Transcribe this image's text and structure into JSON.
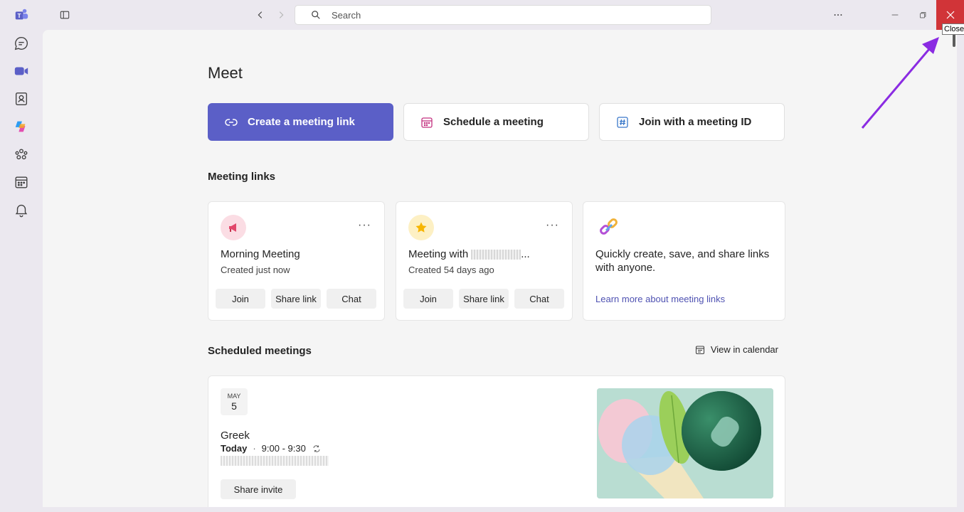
{
  "titlebar": {
    "search_placeholder": "Search",
    "close_tooltip": "Close"
  },
  "rail": [
    {
      "icon": "teams-logo-icon"
    },
    {
      "icon": "chat-icon"
    },
    {
      "icon": "meet-icon"
    },
    {
      "icon": "contacts-icon"
    },
    {
      "icon": "copilot-icon"
    },
    {
      "icon": "communities-icon"
    },
    {
      "icon": "calendar-icon"
    },
    {
      "icon": "bell-icon"
    }
  ],
  "page": {
    "title": "Meet",
    "actions": {
      "create_link": "Create a meeting link",
      "schedule": "Schedule a meeting",
      "join_id": "Join with a meeting ID"
    }
  },
  "meeting_links": {
    "title": "Meeting links",
    "cards": [
      {
        "title": "Morning Meeting",
        "subtitle": "Created just now",
        "more": "···",
        "join": "Join",
        "share": "Share link",
        "chat": "Chat"
      },
      {
        "title": "Meeting with",
        "title_suffix": "...",
        "subtitle": "Created 54 days ago",
        "more": "···",
        "join": "Join",
        "share": "Share link",
        "chat": "Chat"
      }
    ],
    "info": {
      "text": "Quickly create, save, and share links with anyone.",
      "link": "Learn more about meeting links"
    }
  },
  "scheduled": {
    "title": "Scheduled meetings",
    "view_calendar": "View in calendar",
    "meeting": {
      "month": "MAY",
      "day": "5",
      "name": "Greek",
      "day_label": "Today",
      "separator": "·",
      "time": "9:00 - 9:30",
      "share_invite": "Share invite"
    }
  },
  "colors": {
    "accent": "#5b5fc7",
    "close_red": "#d13438",
    "annotation_arrow": "#8a2be2"
  }
}
